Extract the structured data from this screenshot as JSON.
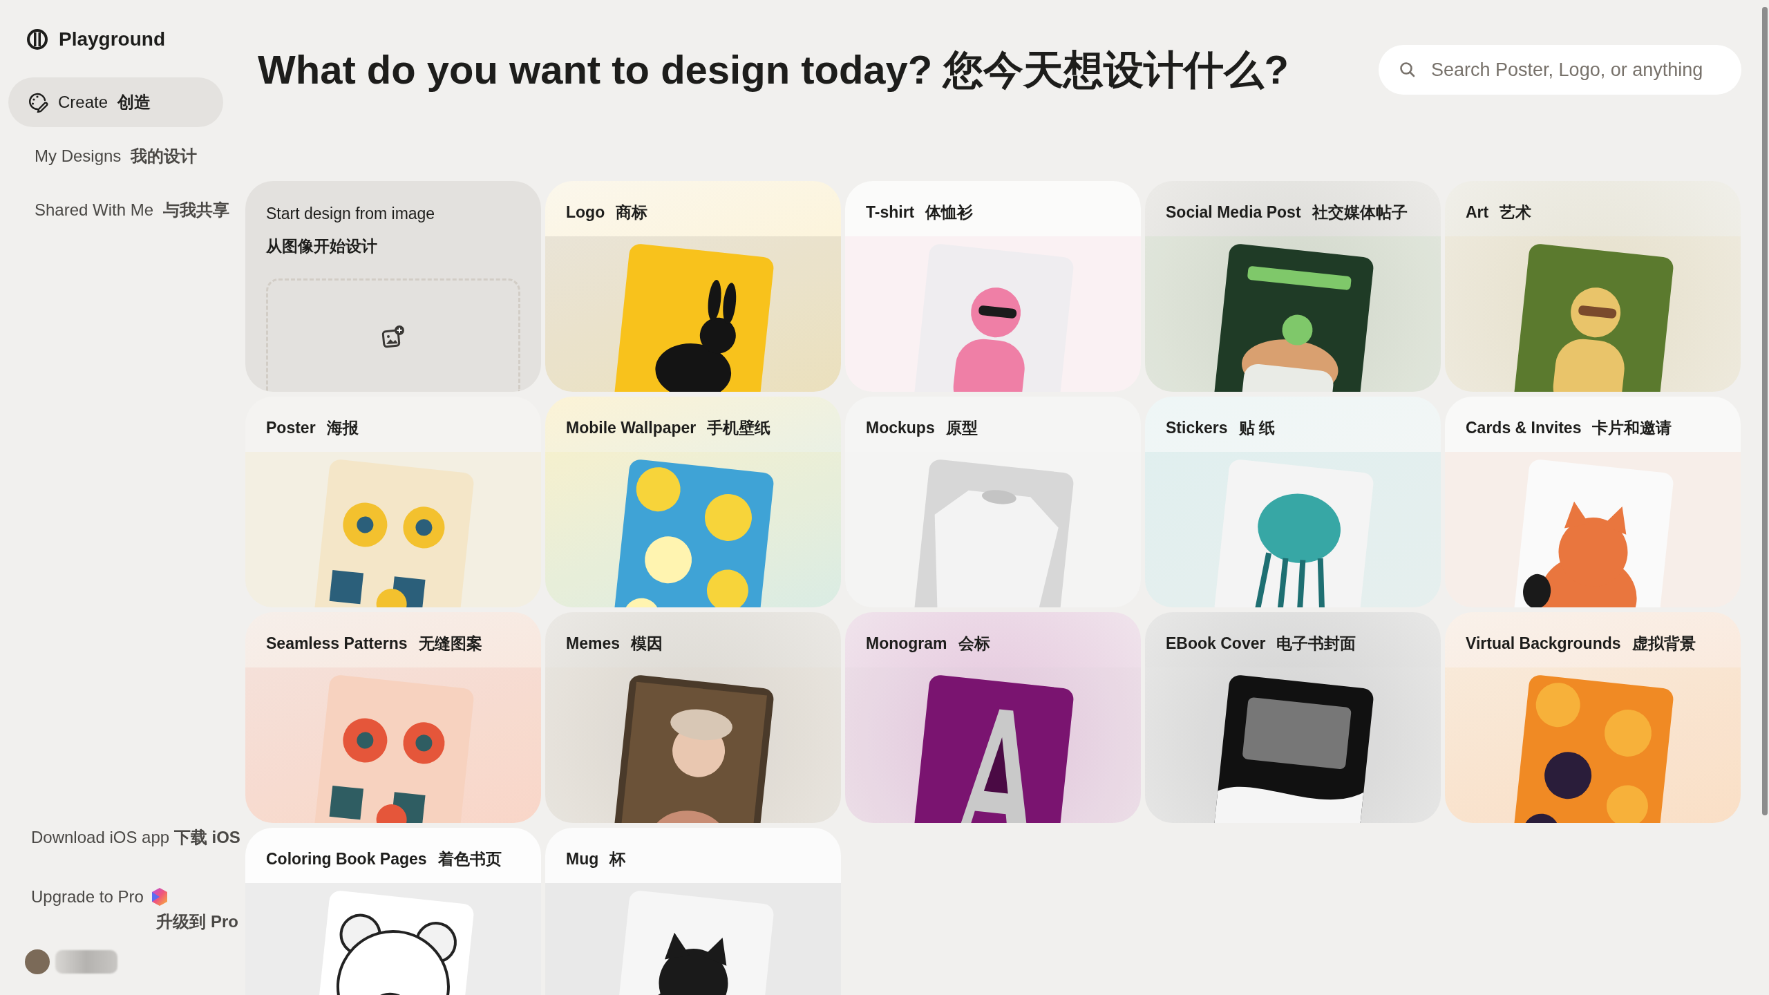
{
  "brand": {
    "name": "Playground"
  },
  "sidebar": {
    "items": [
      {
        "label": "Create",
        "label_zh": "创造",
        "selected": true
      },
      {
        "label": "My Designs",
        "label_zh": "我的设计",
        "selected": false
      },
      {
        "label": "Shared With Me",
        "label_zh": "与我共享",
        "selected": false
      }
    ],
    "download": {
      "label": "Download iOS app",
      "label_zh": "下载 iOS"
    },
    "upgrade": {
      "label": "Upgrade to Pro",
      "label_zh": "升级到 Pro"
    }
  },
  "heading": "What do you want to design today? 您今天想设计什么?",
  "search": {
    "placeholder": "Search Poster, Logo, or anything"
  },
  "cards": [
    {
      "kind": "upload",
      "label": "Start design from image",
      "label_zh": "从图像开始设计"
    },
    {
      "kind": "template",
      "label": "Logo",
      "label_zh": "商标"
    },
    {
      "kind": "template",
      "label": "T-shirt",
      "label_zh": "体恤衫"
    },
    {
      "kind": "template",
      "label": "Social Media Post",
      "label_zh": "社交媒体帖子"
    },
    {
      "kind": "template",
      "label": "Art",
      "label_zh": "艺术"
    },
    {
      "kind": "template",
      "label": "Poster",
      "label_zh": "海报"
    },
    {
      "kind": "template",
      "label": "Mobile Wallpaper",
      "label_zh": "手机壁纸"
    },
    {
      "kind": "template",
      "label": "Mockups",
      "label_zh": "原型"
    },
    {
      "kind": "template",
      "label": "Stickers",
      "label_zh": "贴 纸"
    },
    {
      "kind": "template",
      "label": "Cards & Invites",
      "label_zh": "卡片和邀请"
    },
    {
      "kind": "template",
      "label": "Seamless Patterns",
      "label_zh": "无缝图案"
    },
    {
      "kind": "template",
      "label": "Memes",
      "label_zh": "模因"
    },
    {
      "kind": "template",
      "label": "Monogram",
      "label_zh": "会标"
    },
    {
      "kind": "template",
      "label": "EBook Cover",
      "label_zh": "电子书封面"
    },
    {
      "kind": "template",
      "label": "Virtual Backgrounds",
      "label_zh": "虚拟背景"
    },
    {
      "kind": "template",
      "label": "Coloring Book Pages",
      "label_zh": "着色书页"
    },
    {
      "kind": "template",
      "label": "Mug",
      "label_zh": "杯"
    }
  ]
}
